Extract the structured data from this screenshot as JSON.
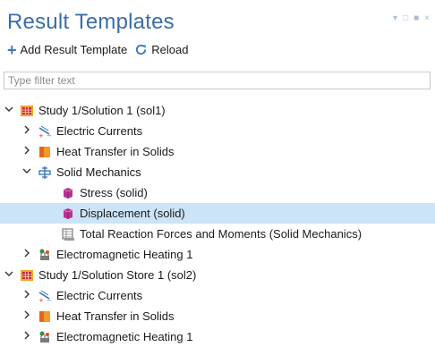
{
  "title": "Result Templates",
  "window_controls": [
    "▾",
    "□",
    "■",
    "×"
  ],
  "toolbar": {
    "add_label": "Add Result Template",
    "reload_label": "Reload"
  },
  "filter": {
    "placeholder": "Type filter text",
    "value": ""
  },
  "tree": [
    {
      "label": "Study 1/Solution 1 (sol1)",
      "chevron": "⌄",
      "icon": "study"
    },
    {
      "label": "Electric Currents",
      "chevron": "›",
      "icon": "electric"
    },
    {
      "label": "Heat Transfer in Solids",
      "chevron": "›",
      "icon": "heat"
    },
    {
      "label": "Solid Mechanics",
      "chevron": "⌄",
      "icon": "solid"
    },
    {
      "label": "Stress (solid)",
      "chevron": "",
      "icon": "cube"
    },
    {
      "label": "Displacement (solid)",
      "chevron": "",
      "icon": "cube",
      "selected": true
    },
    {
      "label": "Total Reaction Forces and Moments (Solid Mechanics)",
      "chevron": "",
      "icon": "table"
    },
    {
      "label": "Electromagnetic Heating 1",
      "chevron": "›",
      "icon": "emheat"
    },
    {
      "label": "Study 1/Solution Store 1 (sol2)",
      "chevron": "⌄",
      "icon": "study"
    },
    {
      "label": "Electric Currents",
      "chevron": "›",
      "icon": "electric"
    },
    {
      "label": "Heat Transfer in Solids",
      "chevron": "›",
      "icon": "heat"
    },
    {
      "label": "Electromagnetic Heating 1",
      "chevron": "›",
      "icon": "emheat"
    }
  ]
}
